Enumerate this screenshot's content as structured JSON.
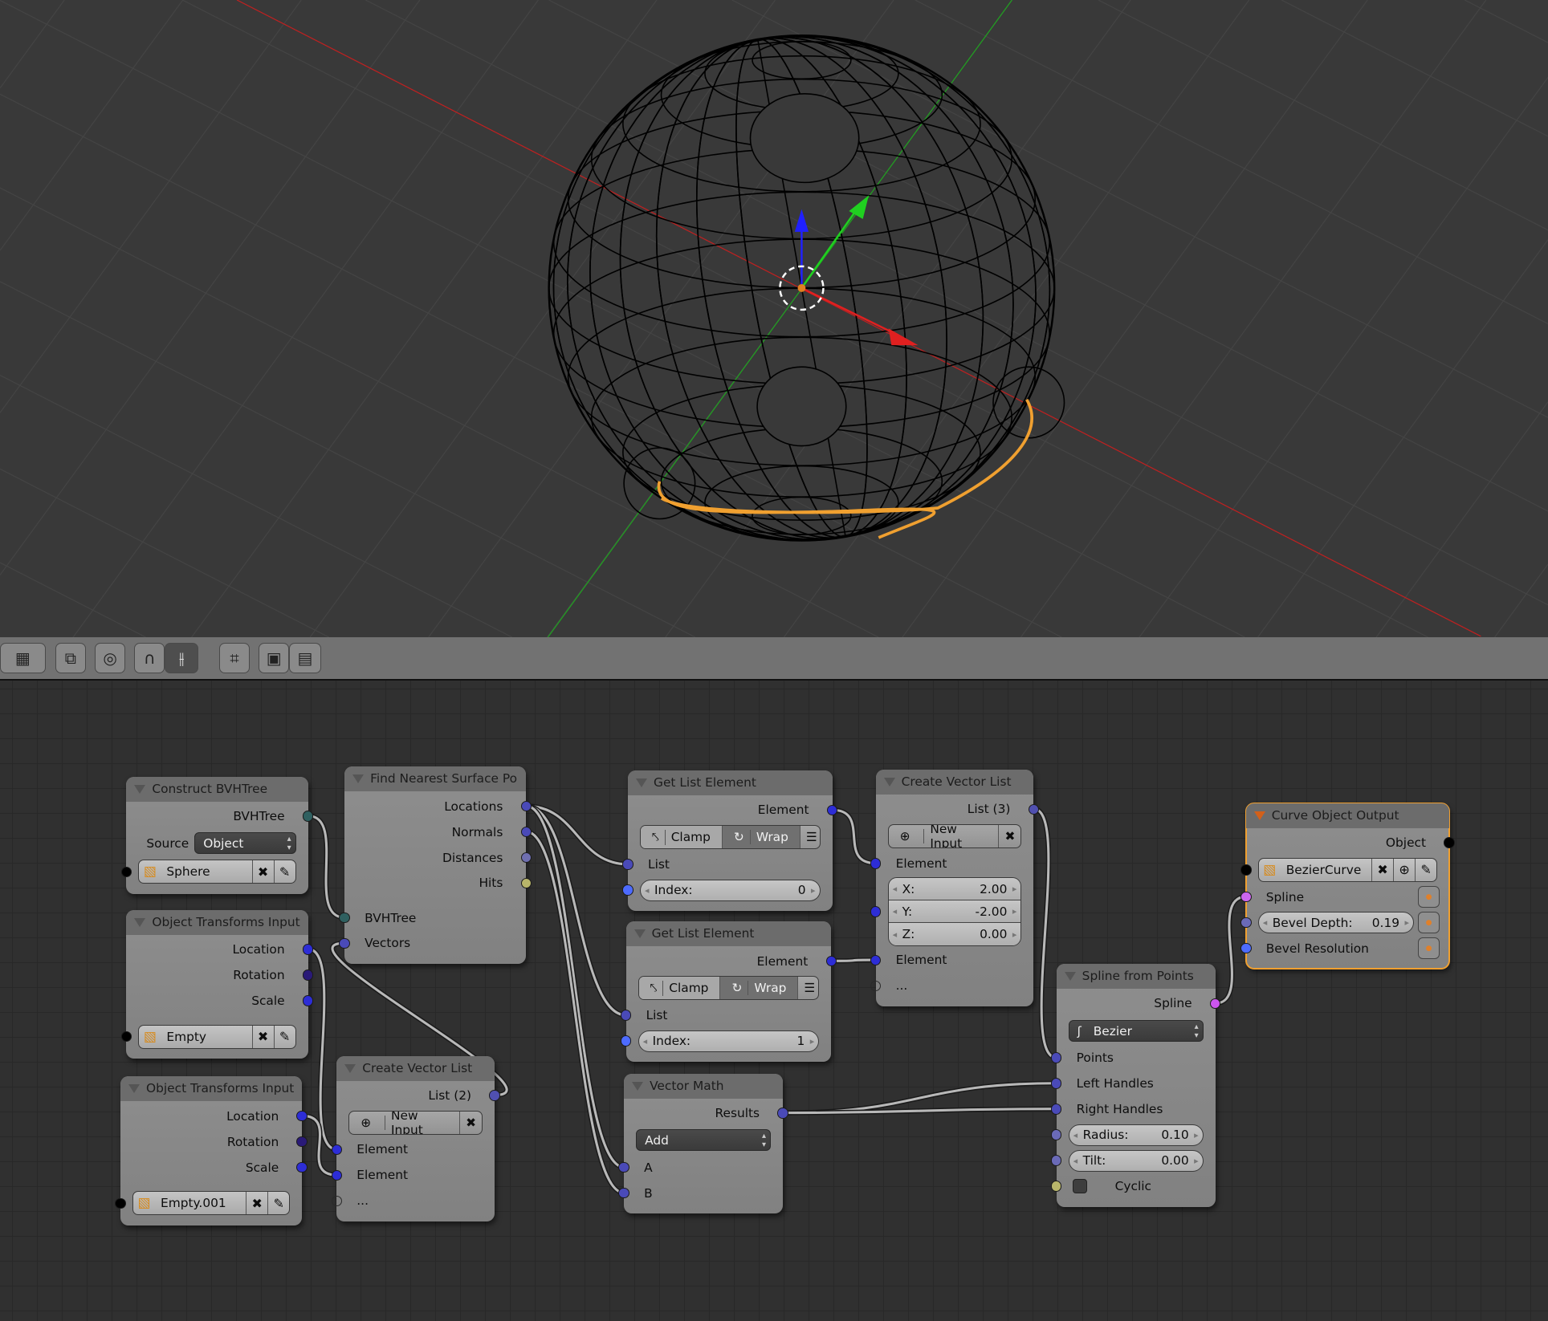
{
  "toolbar": {
    "buttons": [
      {
        "icon": "layout-grid-icon",
        "glyph": "▦"
      },
      {
        "icon": "linked-view-icon",
        "glyph": "⧉"
      },
      {
        "icon": "proportional-edit-icon",
        "glyph": "◎"
      },
      {
        "icon": "snap-magnet-icon",
        "glyph": "∩"
      },
      {
        "icon": "snap-element-icon",
        "glyph": "⫲"
      },
      {
        "icon": "snap-target-icon",
        "glyph": "⌗"
      },
      {
        "icon": "render-still-icon",
        "glyph": "▣"
      },
      {
        "icon": "render-animation-icon",
        "glyph": "▤"
      }
    ]
  },
  "viewport": {
    "colors": {
      "x_axis": "#c02020",
      "y_axis": "#20a020",
      "curve": "#f0a030",
      "wire": "#000000"
    }
  },
  "nodes": [
    {
      "title": "Construct BVHTree",
      "rows": [
        {
          "kind": "out",
          "label": "BVHTree",
          "socket": "#2f6060"
        },
        {
          "kind": "dropdown",
          "label": "Source",
          "value": "Object"
        },
        {
          "kind": "object",
          "value": "Sphere",
          "socket": "#000000"
        }
      ]
    },
    {
      "title": "Object Transforms Input",
      "rows": [
        {
          "kind": "out",
          "label": "Location",
          "socket": "#2d2dd6"
        },
        {
          "kind": "out",
          "label": "Rotation",
          "socket": "#2a1a78"
        },
        {
          "kind": "out",
          "label": "Scale",
          "socket": "#2d2dd6"
        },
        {
          "kind": "gap"
        },
        {
          "kind": "object",
          "value": "Empty",
          "socket": "#000000"
        }
      ]
    },
    {
      "title": "Object Transforms Input",
      "rows": [
        {
          "kind": "out",
          "label": "Location",
          "socket": "#2d2dd6"
        },
        {
          "kind": "out",
          "label": "Rotation",
          "socket": "#2a1a78"
        },
        {
          "kind": "out",
          "label": "Scale",
          "socket": "#2d2dd6"
        },
        {
          "kind": "gap"
        },
        {
          "kind": "object",
          "value": "Empty.001",
          "socket": "#000000"
        }
      ]
    },
    {
      "title": "Find Nearest Surface Po",
      "rows": [
        {
          "kind": "out",
          "label": "Locations",
          "socket": "#4a4ab8"
        },
        {
          "kind": "out",
          "label": "Normals",
          "socket": "#4a4ab8"
        },
        {
          "kind": "out",
          "label": "Distances",
          "socket": "#6f6fb0"
        },
        {
          "kind": "out",
          "label": "Hits",
          "socket": "#b8b56a"
        },
        {
          "kind": "gap"
        },
        {
          "kind": "in",
          "label": "BVHTree",
          "socket": "#2f6060"
        },
        {
          "kind": "in",
          "label": "Vectors",
          "socket": "#4a4ab8"
        }
      ]
    },
    {
      "title": "Create Vector List",
      "rows": [
        {
          "kind": "out",
          "label": "List (2)",
          "socket": "#5050b0"
        },
        {
          "kind": "newinput",
          "label": "New Input"
        },
        {
          "kind": "in",
          "label": "Element",
          "socket": "#2d2dd6"
        },
        {
          "kind": "in",
          "label": "Element",
          "socket": "#2d2dd6"
        },
        {
          "kind": "in",
          "label": "...",
          "socket": "hollow"
        }
      ]
    },
    {
      "title": "Get List Element",
      "rows": [
        {
          "kind": "out",
          "label": "Element",
          "socket": "#2d2dd6"
        },
        {
          "kind": "listbtns",
          "clamp": "Clamp",
          "wrap": "Wrap"
        },
        {
          "kind": "in",
          "label": "List",
          "socket": "#4a4ab8"
        },
        {
          "kind": "num",
          "label": "Index:",
          "value": "0",
          "socket": "#4d6bff"
        }
      ]
    },
    {
      "title": "Get List Element",
      "rows": [
        {
          "kind": "out",
          "label": "Element",
          "socket": "#2d2dd6"
        },
        {
          "kind": "listbtns",
          "clamp": "Clamp",
          "wrap": "Wrap"
        },
        {
          "kind": "in",
          "label": "List",
          "socket": "#4a4ab8"
        },
        {
          "kind": "num",
          "label": "Index:",
          "value": "1",
          "socket": "#4d6bff"
        }
      ]
    },
    {
      "title": "Vector Math",
      "rows": [
        {
          "kind": "out",
          "label": "Results",
          "socket": "#4a4ab8"
        },
        {
          "kind": "dropdown",
          "label": "",
          "value": "Add"
        },
        {
          "kind": "in",
          "label": "A",
          "socket": "#4a4ab8"
        },
        {
          "kind": "in",
          "label": "B",
          "socket": "#4a4ab8"
        }
      ]
    },
    {
      "title": "Create Vector List",
      "rows": [
        {
          "kind": "out",
          "label": "List (3)",
          "socket": "#5050b0"
        },
        {
          "kind": "newinput",
          "label": "New Input"
        },
        {
          "kind": "in",
          "label": "Element",
          "socket": "#2d2dd6"
        },
        {
          "kind": "vec",
          "x": "2.00",
          "y": "-2.00",
          "z": "0.00",
          "socket": "#2d2dd6"
        },
        {
          "kind": "in",
          "label": "Element",
          "socket": "#2d2dd6"
        },
        {
          "kind": "in",
          "label": "...",
          "socket": "hollow"
        }
      ]
    },
    {
      "title": "Spline from Points",
      "rows": [
        {
          "kind": "out",
          "label": "Spline",
          "socket": "#cc55ee"
        },
        {
          "kind": "dropdown",
          "label": "",
          "value": "Bezier",
          "icon": "bezier-icon"
        },
        {
          "kind": "in",
          "label": "Points",
          "socket": "#4a4ab8"
        },
        {
          "kind": "in",
          "label": "Left Handles",
          "socket": "#4a4ab8"
        },
        {
          "kind": "in",
          "label": "Right Handles",
          "socket": "#4a4ab8"
        },
        {
          "kind": "num",
          "label": "Radius:",
          "value": "0.10",
          "socket": "#6a6ab8"
        },
        {
          "kind": "num",
          "label": "Tilt:",
          "value": "0.00",
          "socket": "#6a6ab8"
        },
        {
          "kind": "check",
          "label": "Cyclic",
          "checked": false,
          "socket": "#b8b56a"
        }
      ]
    },
    {
      "title": "Curve Object Output",
      "selected": true,
      "rows": [
        {
          "kind": "out",
          "label": "Object",
          "socket": "#000000"
        },
        {
          "kind": "object",
          "value": "BezierCurve",
          "socket": "#000000",
          "plus": true
        },
        {
          "kind": "in",
          "label": "Spline",
          "socket": "#cc66ee",
          "side": true
        },
        {
          "kind": "num",
          "label": "Bevel Depth:",
          "value": "0.19",
          "socket": "#6a6ab8",
          "side": true
        },
        {
          "kind": "in",
          "label": "Bevel Resolution",
          "socket": "#4d6bff",
          "side": true
        }
      ]
    }
  ]
}
